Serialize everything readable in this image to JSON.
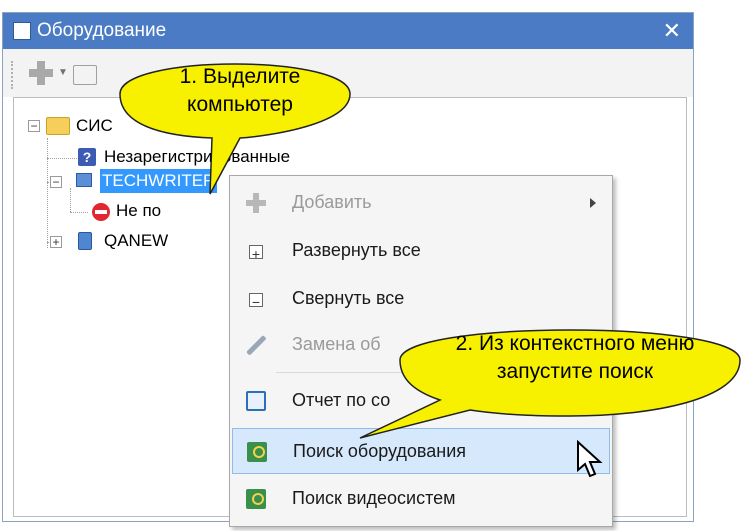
{
  "window": {
    "title": "Оборудование",
    "close_glyph": "✕"
  },
  "tree": {
    "root_label": "СИС",
    "unregistered_label": "Незарегистрированные",
    "computer_label": "TECHWRITER",
    "not_label": "Не по",
    "qanew_label": "QANEW",
    "expander_minus": "−",
    "expander_plus": "+"
  },
  "context_menu": {
    "items": [
      {
        "label": "Добавить",
        "icon": "add-icon",
        "disabled": true,
        "submenu": true
      },
      {
        "label": "Развернуть все",
        "icon": "expand-all-icon"
      },
      {
        "label": "Свернуть все",
        "icon": "collapse-all-icon"
      },
      {
        "label": "Замена об",
        "icon": "wrench-icon",
        "disabled": true
      },
      {
        "label": "Отчет по со",
        "icon": "report-icon"
      },
      {
        "label": "Поиск оборудования",
        "icon": "search-hardware-icon",
        "highlighted": true
      },
      {
        "label": "Поиск видеосистем",
        "icon": "search-video-icon"
      }
    ],
    "box_plus": "+",
    "box_minus": "−"
  },
  "callouts": {
    "step1": "1. Выделите компьютер",
    "step2": "2. Из контекстного меню запустите поиск"
  },
  "colors": {
    "titlebar": "#4a7bc4",
    "selection": "#3399ff",
    "callout_fill": "#f7f100",
    "menu_hover": "#d6e8fb"
  }
}
